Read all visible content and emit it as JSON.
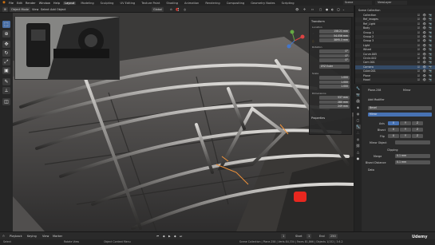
{
  "topbar": {
    "menus": [
      "File",
      "Edit",
      "Render",
      "Window",
      "Help"
    ],
    "workspaces": [
      "Layout",
      "Modeling",
      "Sculpting",
      "UV Editing",
      "Texture Paint",
      "Shading",
      "Animation",
      "Rendering",
      "Compositing",
      "Geometry Nodes",
      "Scripting"
    ],
    "active_workspace": "Layout",
    "scene": "Scene",
    "view_layer": "ViewLayer"
  },
  "header": {
    "mode": "Object Mode",
    "menus": [
      "View",
      "Select",
      "Add",
      "Object"
    ],
    "transform": "Global",
    "options": "Options"
  },
  "tools": [
    {
      "icon": "cursor-select-icon",
      "glyph": "⬚",
      "active": true
    },
    {
      "icon": "cursor-icon",
      "glyph": "⊕",
      "active": false
    },
    {
      "icon": "move-icon",
      "glyph": "✥",
      "active": false
    },
    {
      "icon": "rotate-icon",
      "glyph": "↻",
      "active": false
    },
    {
      "icon": "scale-icon",
      "glyph": "⤢",
      "active": false
    },
    {
      "icon": "transform-icon",
      "glyph": "▣",
      "active": false
    },
    {
      "icon": "annotate-icon",
      "glyph": "✎",
      "active": false
    },
    {
      "icon": "measure-icon",
      "glyph": "📏",
      "active": false
    },
    {
      "icon": "add-cube-icon",
      "glyph": "◫",
      "active": false
    }
  ],
  "npanel": {
    "title": "Transform",
    "location": {
      "label": "Location",
      "x": "158.21 mm",
      "y": "54.056 mm",
      "z": "3895.3 mm"
    },
    "rotation": {
      "label": "Rotation",
      "x": "0°",
      "y": "0°",
      "z": "0°"
    },
    "mode": "XYZ Euler",
    "scale": {
      "label": "Scale",
      "x": "1.000",
      "y": "1.000",
      "z": "1.000"
    },
    "dimensions": {
      "label": "Dimensions",
      "x": "537 mm",
      "y": "280 mm",
      "z": "249 mm"
    },
    "delta": "Properties"
  },
  "outliner": {
    "title": "Scene Collection",
    "rows": [
      {
        "name": "Collection",
        "sel": false
      },
      {
        "name": "Ref_images",
        "sel": false
      },
      {
        "name": "Ref_Light",
        "sel": false
      },
      {
        "name": "Body",
        "sel": false
      },
      {
        "name": "Group 1",
        "sel": false
      },
      {
        "name": "Group 2",
        "sel": false
      },
      {
        "name": "Group 3",
        "sel": false
      },
      {
        "name": "Light",
        "sel": false
      },
      {
        "name": "Wheel",
        "sel": false
      },
      {
        "name": "Curve.005",
        "sel": false
      },
      {
        "name": "Circle.002",
        "sel": false
      },
      {
        "name": "Cam 001",
        "sel": false
      },
      {
        "name": "Camera",
        "sel": true
      },
      {
        "name": "Cube.001",
        "sel": false
      },
      {
        "name": "Plane",
        "sel": false
      },
      {
        "name": "Hood",
        "sel": false
      }
    ]
  },
  "properties": {
    "object": "Plane.258",
    "modifier_tab": "Mirror",
    "add_modifier": "Add Modifier",
    "modifiers": [
      "Bevel",
      "Mirror"
    ],
    "axis_label": "Axis",
    "bisect_label": "Bisect",
    "flip_label": "Flip",
    "axes": [
      "X",
      "Y",
      "Z"
    ],
    "mirror_object": "Mirror Object",
    "clipping": "Clipping",
    "merge": "Merge",
    "merge_value": "0.1 mm",
    "bisect_distance": "Bisect Distance",
    "bisect_value": "0.1 mm",
    "data": "Data"
  },
  "timeline": {
    "playback": "Playback",
    "keying": "Keying",
    "view": "View",
    "marker": "Marker",
    "frame": "1",
    "start": "Start",
    "start_val": "1",
    "end": "End",
    "end_val": "250"
  },
  "status": {
    "left": "Select",
    "middle": "Rotate View",
    "right": "Object Context Menu",
    "stats": "Scene Collection | Plane.258 | Verts 84,334 | Faces 81,866 | Objects 1/152 | 3.6.2",
    "watermark": "Udemy"
  },
  "colors": {
    "accent": "#4772b3",
    "selection": "#344a66",
    "record": "#e8271f"
  }
}
